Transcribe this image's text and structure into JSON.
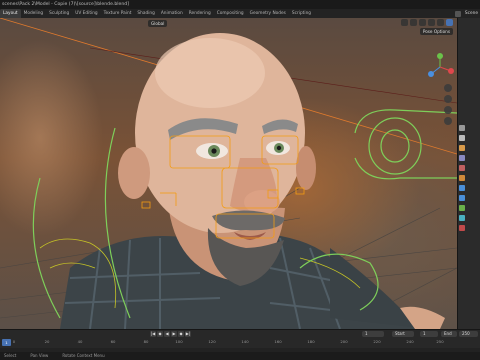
{
  "window": {
    "file_path": "scenes\\Pack 2\\Model - Copie (7)\\[source]\\blende.blend]"
  },
  "workspaces": {
    "tabs": [
      "Layout",
      "Modeling",
      "Sculpting",
      "UV Editing",
      "Texture Paint",
      "Shading",
      "Animation",
      "Rendering",
      "Compositing",
      "Geometry Nodes",
      "Scripting"
    ],
    "active": "Layout",
    "scene_label": "Scene"
  },
  "viewport": {
    "interaction_mode": "Global",
    "pose_options_label": "Pose Options",
    "colors": {
      "background_warm": "#7a5236",
      "bone_outline": "#f39c12",
      "controller": "#7ecf5a"
    }
  },
  "timeline": {
    "current_frame": "1",
    "start_label": "Start",
    "start_value": "1",
    "end_label": "End",
    "end_value": "250",
    "ticks": [
      "0",
      "20",
      "40",
      "60",
      "80",
      "100",
      "120",
      "140",
      "160",
      "180",
      "200",
      "220",
      "240",
      "250"
    ],
    "playhead": "1"
  },
  "statusbar": {
    "items": [
      "Select",
      "Pan View",
      "Rotate Context Menu"
    ]
  },
  "icons": {
    "play": "play-icon",
    "jump_start": "jump-start-icon",
    "jump_end": "jump-end-icon",
    "keyframe_prev": "keyframe-prev-icon",
    "keyframe_next": "keyframe-next-icon"
  }
}
